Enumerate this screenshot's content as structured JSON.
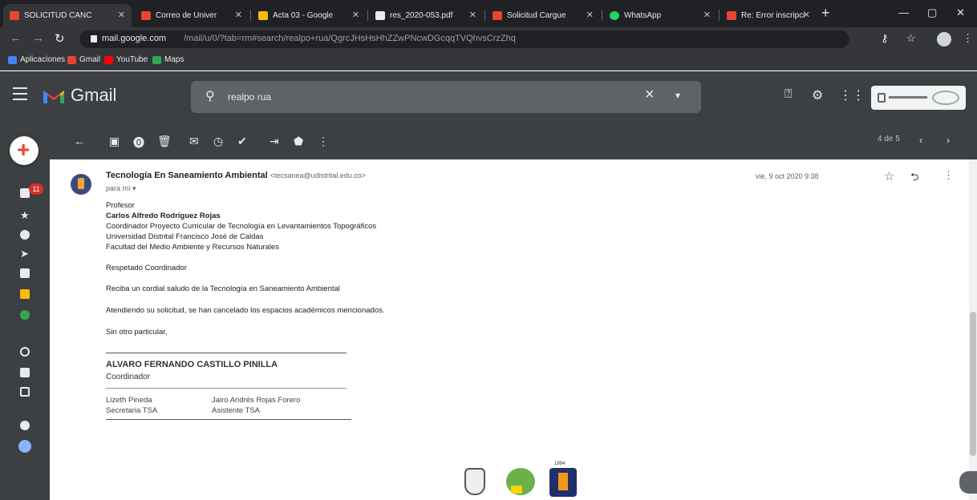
{
  "browser": {
    "tabs": [
      {
        "title": "SOLICITUD CANC",
        "color": "#ea4335"
      },
      {
        "title": "Correo de Univer",
        "color": "#ea4335"
      },
      {
        "title": "Acta 03 - Google",
        "color": "#fbbc04"
      },
      {
        "title": "res_2020-053.pdf",
        "color": "#e8eaed"
      },
      {
        "title": "Solicitud Cargue",
        "color": "#ea4335"
      },
      {
        "title": "WhatsApp",
        "color": "#25d366"
      },
      {
        "title": "Re: Error inscripci",
        "color": "#ea4335"
      }
    ],
    "address": {
      "domain": "mail.google.com",
      "path": "/mail/u/0/?tab=rm#search/realpo+rua/QgrcJHsHsHhZZwPNcwDGcqqTVQhvsCrzZhq"
    },
    "bookmarks": [
      {
        "label": "Aplicaciones",
        "color": "#4285f4"
      },
      {
        "label": "Gmail",
        "color": "#ea4335"
      },
      {
        "label": "YouTube",
        "color": "#ff0000"
      },
      {
        "label": "Maps",
        "color": "#34a853"
      }
    ]
  },
  "gmail": {
    "logo_text": "Gmail",
    "search_query": "realpo rua",
    "pager": "4 de 5"
  },
  "rail": {
    "badge": "11"
  },
  "message": {
    "sender_name": "Tecnología En Saneamiento Ambiental",
    "sender_email": "<tecsanea@udistrital.edu.co>",
    "to": "para mí",
    "date": "vie, 9 oct 2020 9:38",
    "body": {
      "greeting_title": "Profesor",
      "recipient_name": "Carlos Alfredo Rodríguez Rojas",
      "recipient_role": "Coordinador Proyecto Curricular de Tecnología en Levantamientos Topográficos",
      "university": "Universidad Distrital Francisco José de Caldas",
      "faculty": "Facultad del Medio Ambiente y Recursos Naturales",
      "salutation": "Respetado Coordinador",
      "p1": "Reciba un cordial saludo de la Tecnología en Saneamiento Ambiental",
      "p2": "Atendiendo su solicitud, se han cancelado los espacios académicos mencionados.",
      "closing": "Sin otro particular,",
      "signer_name": "ALVARO FERNANDO CASTILLO PINILLA",
      "signer_role": "Coordinador",
      "staff1_name": "Lizeth Pineda",
      "staff1_role": "Secretaria TSA",
      "staff2_name": "Jairo Andrés Rojas Forero",
      "staff2_role": "Asistente TSA",
      "logo_caption": "1994"
    }
  }
}
